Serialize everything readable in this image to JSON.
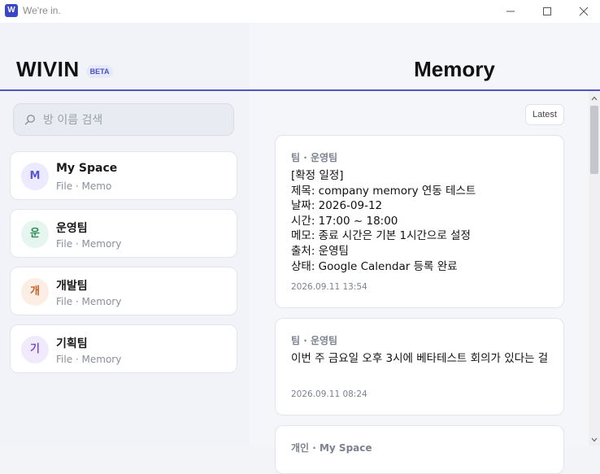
{
  "window": {
    "title": "We're in.",
    "app_icon": "W"
  },
  "sidebar": {
    "brand": "WIVIN",
    "badge": "BETA",
    "search": {
      "placeholder": "방 이름 검색",
      "value": ""
    },
    "rooms": [
      {
        "initial": "M",
        "name": "My Space",
        "sub": "File · Memo",
        "avatar_bg": "#ebeafe",
        "avatar_fg": "#5b55d6"
      },
      {
        "initial": "운",
        "name": "운영팀",
        "sub": "File · Memory",
        "avatar_bg": "#e6f6ee",
        "avatar_fg": "#2f8a5a"
      },
      {
        "initial": "개",
        "name": "개발팀",
        "sub": "File · Memory",
        "avatar_bg": "#fdeee5",
        "avatar_fg": "#c2622a"
      },
      {
        "initial": "기",
        "name": "기획팀",
        "sub": "File · Memory",
        "avatar_bg": "#f1eafd",
        "avatar_fg": "#7b4fc9"
      }
    ]
  },
  "main": {
    "title": "Memory",
    "sort_label": "Latest",
    "cards": [
      {
        "meta": "팀 · 운영팀",
        "body": "[확정 일정]\n제목: company memory 연동 테스트\n날짜: 2026-09-12\n시간: 17:00 ~ 18:00\n메모: 종료 시간은 기본 1시간으로 설정\n출처: 운영팀\n상태: Google Calendar 등록 완료",
        "time": "2026.09.11 13:54"
      },
      {
        "meta": "팀 · 운영팀",
        "body": "이번 주 금요일 오후 3시에 베타테스트 회의가 있다는 걸",
        "time": "2026.09.11 08:24"
      },
      {
        "meta": "개인 · My Space",
        "body": "",
        "time": ""
      }
    ]
  },
  "colors": {
    "accent": "#5256c0",
    "background": "#f3f4f8"
  }
}
